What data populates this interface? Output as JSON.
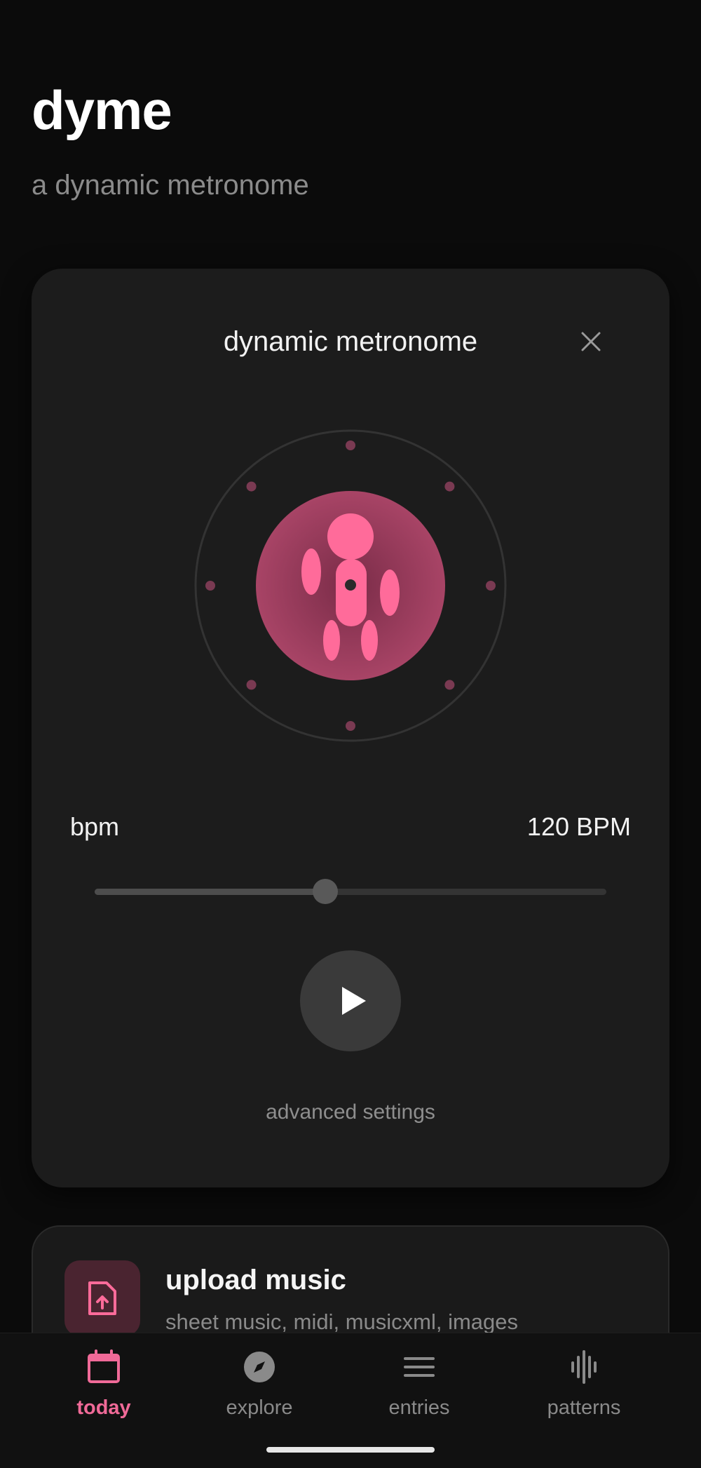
{
  "app": {
    "title": "dyme",
    "subtitle": "a dynamic metronome"
  },
  "metronome": {
    "title": "dynamic metronome",
    "bpm_label": "bpm",
    "bpm_value": "120 BPM",
    "bpm_slider_fraction": 0.45,
    "advanced_label": "advanced settings",
    "accent_color": "#ff6b9a",
    "beat_dots": 8
  },
  "upload": {
    "title": "upload music",
    "subtitle": "sheet music, midi, musicxml, images",
    "icon": "file-upload-icon"
  },
  "nav": {
    "items": [
      {
        "label": "today",
        "icon": "calendar-icon",
        "active": true
      },
      {
        "label": "explore",
        "icon": "compass-icon",
        "active": false
      },
      {
        "label": "entries",
        "icon": "list-icon",
        "active": false
      },
      {
        "label": "patterns",
        "icon": "waveform-icon",
        "active": false
      }
    ]
  },
  "colors": {
    "background": "#0b0b0b",
    "card": "#1c1c1c",
    "accent": "#f06a98"
  }
}
